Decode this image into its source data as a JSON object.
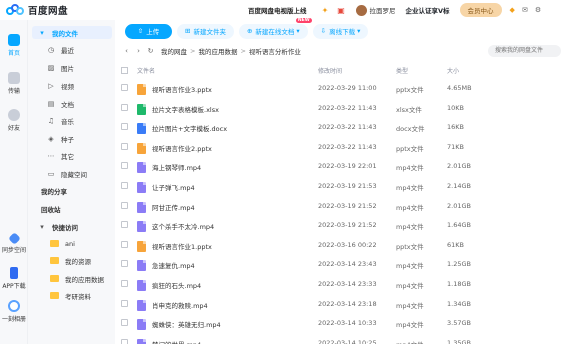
{
  "app": {
    "name": "百度网盘",
    "promo": "百度网盘电视版上线",
    "username": "拉面罗尼",
    "vip_link": "企业认证享V标",
    "member_center": "会员中心"
  },
  "rail": [
    {
      "label": "首页",
      "icon": "home-icon",
      "active": true
    },
    {
      "label": "传输",
      "icon": "transfer-icon"
    },
    {
      "label": "好友",
      "icon": "friends-icon"
    },
    {
      "label": "同步空间",
      "icon": "sync-space-icon"
    },
    {
      "label": "APP下载",
      "icon": "app-download-icon"
    },
    {
      "label": "一刻相册",
      "icon": "album-icon"
    }
  ],
  "sidebar": {
    "items": [
      {
        "label": "我的文件",
        "icon": "my-files-icon",
        "active": true
      },
      {
        "label": "最近",
        "icon": "recent-icon"
      },
      {
        "label": "图片",
        "icon": "image-icon"
      },
      {
        "label": "视频",
        "icon": "video-icon"
      },
      {
        "label": "文档",
        "icon": "document-icon"
      },
      {
        "label": "音乐",
        "icon": "music-icon"
      },
      {
        "label": "种子",
        "icon": "seed-icon"
      },
      {
        "label": "其它",
        "icon": "other-icon"
      },
      {
        "label": "隐藏空间",
        "icon": "hidden-space-icon"
      }
    ],
    "my_share": "我的分享",
    "recycle_bin": "回收站",
    "quick_access": "快捷访问",
    "quick_folders": [
      "ani",
      "我的资源",
      "我的应用数据",
      "考研资料"
    ]
  },
  "toolbar": {
    "upload": "上传",
    "new_folder": "新建文件夹",
    "new_online_doc": "新建在线文档",
    "new_badge": "NEW",
    "offline_download": "离线下载"
  },
  "breadcrumb": [
    "我的网盘",
    "我的应用数据",
    "视听语言分析作业"
  ],
  "search": {
    "placeholder": "搜索我的网盘文件"
  },
  "table": {
    "columns": [
      "文件名",
      "修改时间",
      "类型",
      "大小"
    ],
    "rows": [
      {
        "name": "视听语言作业3.pptx",
        "date": "2022-03-29 11:00",
        "type": "pptx文件",
        "size": "4.65MB",
        "kind": "ppt"
      },
      {
        "name": "拉片文字表格模板.xlsx",
        "date": "2022-03-22 11:43",
        "type": "xlsx文件",
        "size": "10KB",
        "kind": "xls"
      },
      {
        "name": "拉片图片+文字模板.docx",
        "date": "2022-03-22 11:43",
        "type": "docx文件",
        "size": "16KB",
        "kind": "doc"
      },
      {
        "name": "视听语言作业2.pptx",
        "date": "2022-03-22 11:43",
        "type": "pptx文件",
        "size": "71KB",
        "kind": "ppt"
      },
      {
        "name": "海上钢琴师.mp4",
        "date": "2022-03-19 22:01",
        "type": "mp4文件",
        "size": "2.01GB",
        "kind": "mp4"
      },
      {
        "name": "让子弹飞.mp4",
        "date": "2022-03-19 21:53",
        "type": "mp4文件",
        "size": "2.14GB",
        "kind": "mp4"
      },
      {
        "name": "阿甘正传.mp4",
        "date": "2022-03-19 21:52",
        "type": "mp4文件",
        "size": "2.01GB",
        "kind": "mp4"
      },
      {
        "name": "这个杀手不太冷.mp4",
        "date": "2022-03-19 21:52",
        "type": "mp4文件",
        "size": "1.64GB",
        "kind": "mp4"
      },
      {
        "name": "视听语言作业1.pptx",
        "date": "2022-03-16 00:22",
        "type": "pptx文件",
        "size": "61KB",
        "kind": "ppt"
      },
      {
        "name": "急速复仇.mp4",
        "date": "2022-03-14 23:43",
        "type": "mp4文件",
        "size": "1.25GB",
        "kind": "mp4"
      },
      {
        "name": "疯狂的石头.mp4",
        "date": "2022-03-14 23:33",
        "type": "mp4文件",
        "size": "1.18GB",
        "kind": "mp4"
      },
      {
        "name": "肖申克的救赎.mp4",
        "date": "2022-03-14 23:18",
        "type": "mp4文件",
        "size": "1.34GB",
        "kind": "mp4"
      },
      {
        "name": "蜘蛛侠：英雄无归.mp4",
        "date": "2022-03-14 10:33",
        "type": "mp4文件",
        "size": "3.57GB",
        "kind": "mp4"
      },
      {
        "name": "楚门的世界.mp4",
        "date": "2022-03-14 10:25",
        "type": "mp4文件",
        "size": "1.35GB",
        "kind": "mp4"
      }
    ]
  },
  "colors": {
    "accent": "#06a7ff",
    "ppt": "#f7a43a",
    "xls": "#1fb96b",
    "doc": "#3a7cf7",
    "mp4": "#8b7cf6",
    "folder": "#ffc53d"
  }
}
